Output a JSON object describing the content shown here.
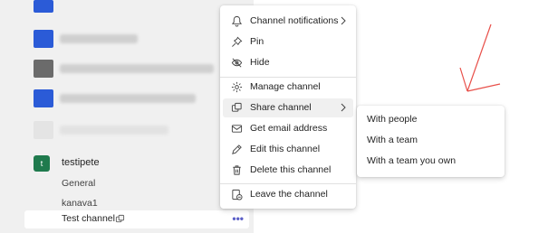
{
  "sidebar": {
    "team": {
      "avatar_letter": "t",
      "name": "testipete",
      "avatar_color": "#1f7a4d"
    },
    "channels": [
      {
        "label": "General"
      },
      {
        "label": "kanava1"
      },
      {
        "label": "Test channel"
      }
    ],
    "more_options_glyph": "•••"
  },
  "context_menu": {
    "items": [
      {
        "label": "Channel notifications",
        "icon": "bell-icon",
        "has_submenu": true
      },
      {
        "label": "Pin",
        "icon": "pin-icon"
      },
      {
        "label": "Hide",
        "icon": "eye-off-icon"
      },
      {
        "label": "Manage channel",
        "icon": "gear-icon"
      },
      {
        "label": "Share channel",
        "icon": "share-icon",
        "has_submenu": true,
        "highlighted": true
      },
      {
        "label": "Get email address",
        "icon": "mail-icon"
      },
      {
        "label": "Edit this channel",
        "icon": "pencil-icon"
      },
      {
        "label": "Delete this channel",
        "icon": "trash-icon"
      },
      {
        "label": "Leave the channel",
        "icon": "leave-icon"
      }
    ]
  },
  "share_submenu": {
    "items": [
      {
        "label": "With people"
      },
      {
        "label": "With a team"
      },
      {
        "label": "With a team you own"
      }
    ]
  },
  "colors": {
    "sidebar_bg": "#f0f0f0",
    "accent": "#5b5fc7",
    "annotation_arrow": "#e8504a",
    "highlight": "#f0f0f0"
  }
}
